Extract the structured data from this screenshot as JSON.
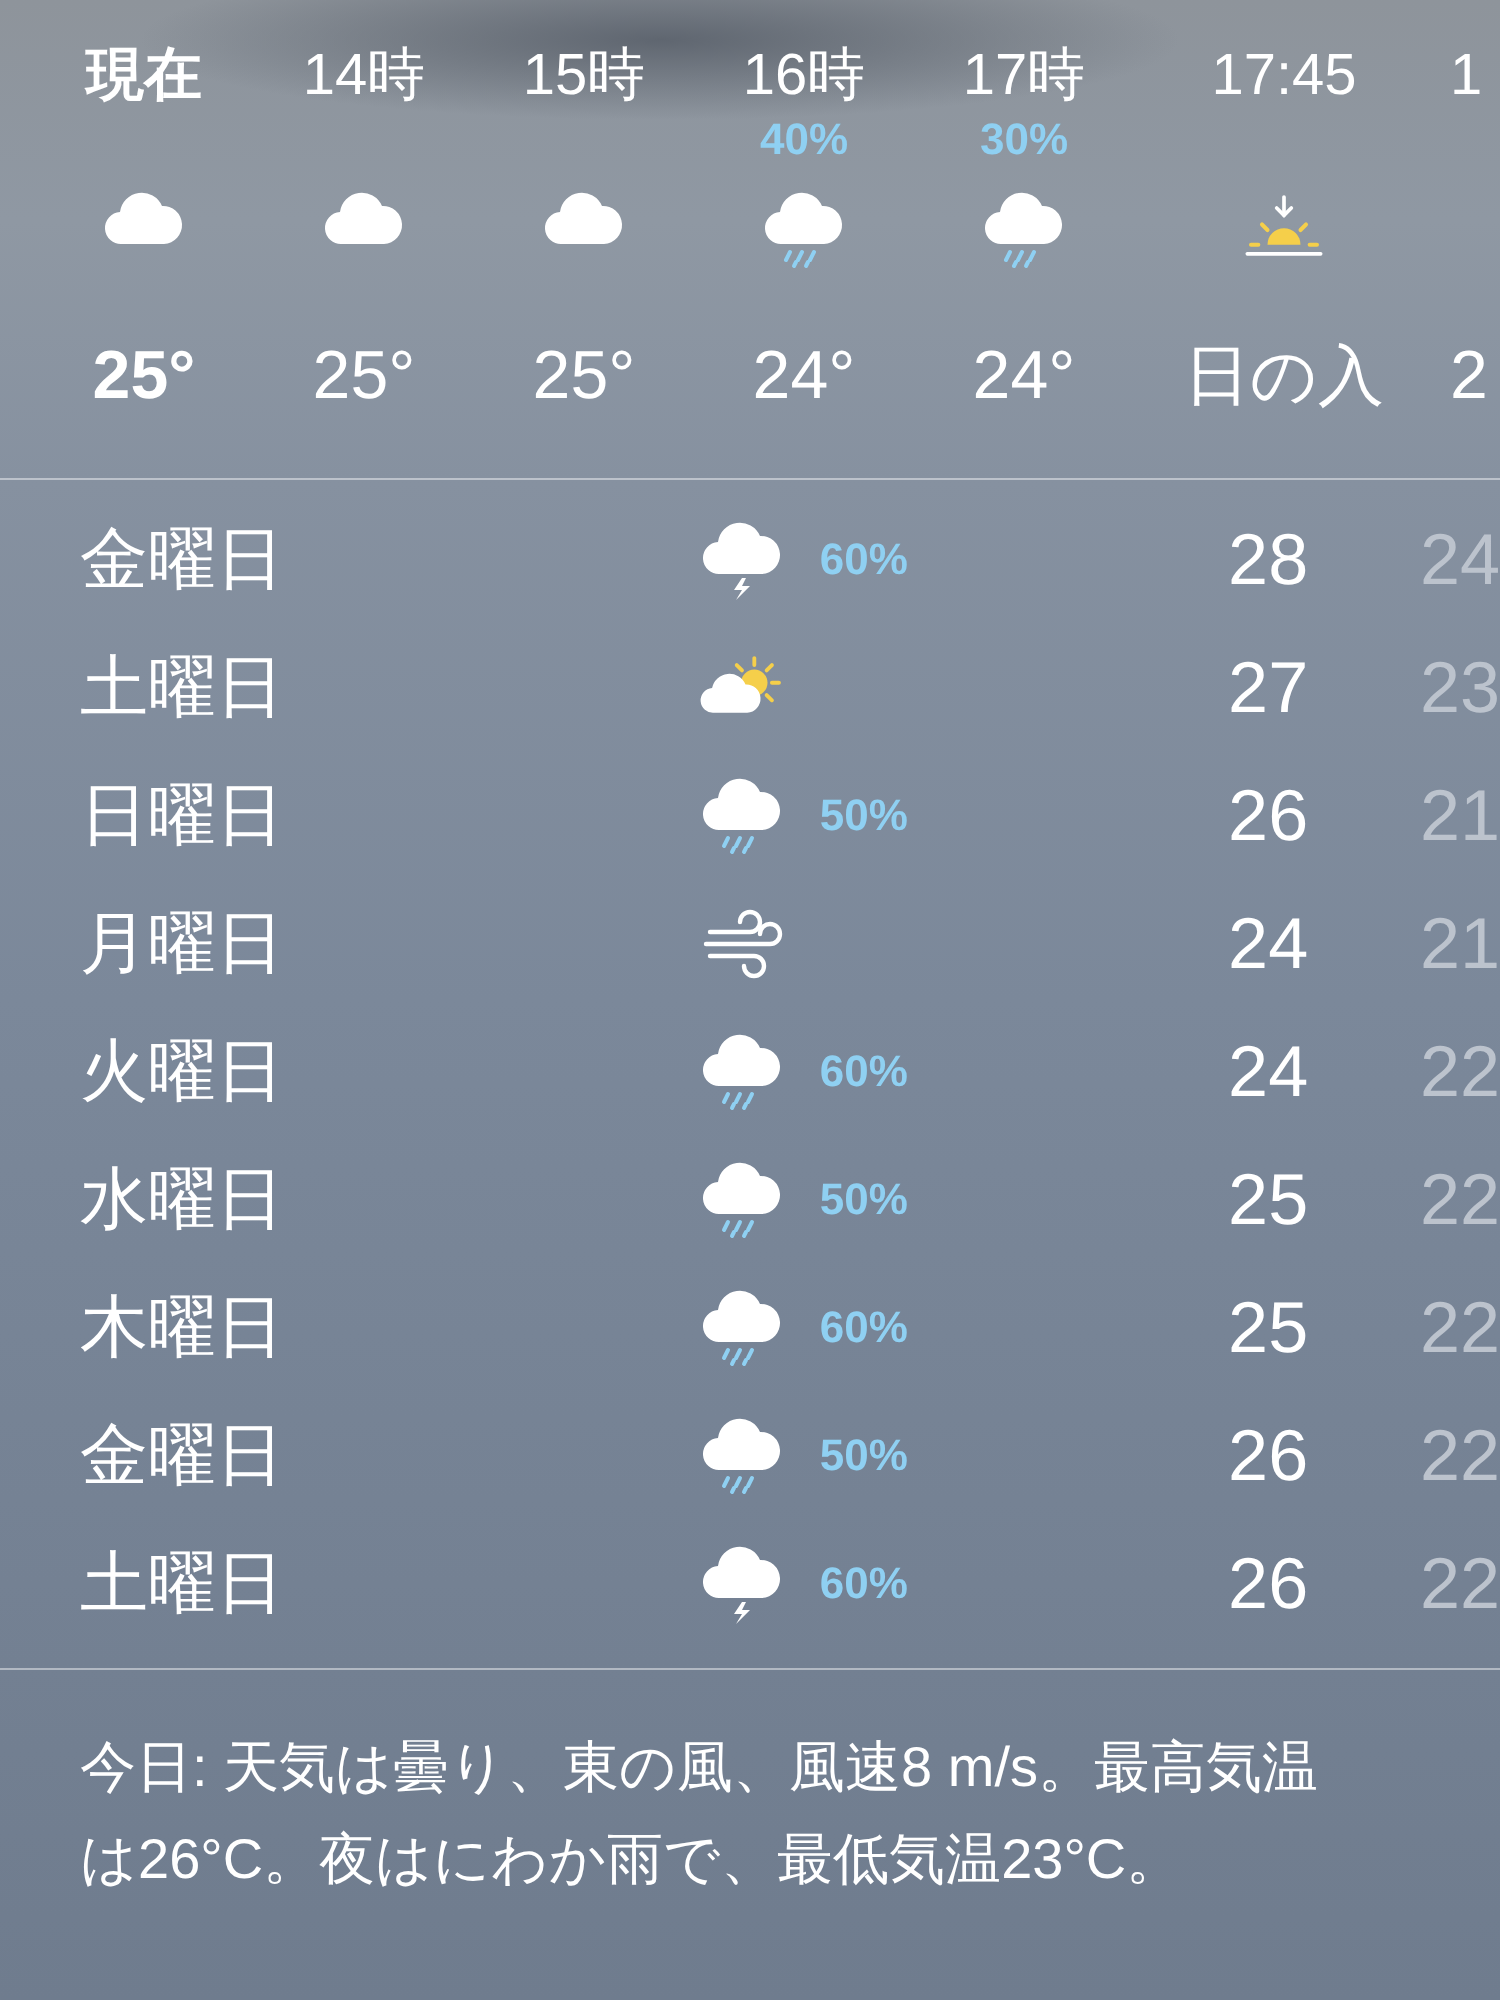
{
  "hourly": [
    {
      "time": "現在",
      "current": true,
      "kind": "cloud",
      "temp": "25°"
    },
    {
      "time": "14時",
      "current": false,
      "kind": "cloud",
      "temp": "25°"
    },
    {
      "time": "15時",
      "current": false,
      "kind": "cloud",
      "temp": "25°"
    },
    {
      "time": "16時",
      "current": false,
      "chance": "40%",
      "kind": "rain",
      "temp": "24°"
    },
    {
      "time": "17時",
      "current": false,
      "chance": "30%",
      "kind": "rain",
      "temp": "24°"
    },
    {
      "time": "17:45",
      "current": false,
      "kind": "sunset",
      "temp": "日の入"
    },
    {
      "time": "1",
      "current": false,
      "temp": "2"
    }
  ],
  "daily": [
    {
      "day": "金曜日",
      "kind": "thunder",
      "chance": "60%",
      "high": "28",
      "low": "24"
    },
    {
      "day": "土曜日",
      "kind": "partly_sunny",
      "high": "27",
      "low": "23"
    },
    {
      "day": "日曜日",
      "kind": "rain",
      "chance": "50%",
      "high": "26",
      "low": "21"
    },
    {
      "day": "月曜日",
      "kind": "wind",
      "high": "24",
      "low": "21"
    },
    {
      "day": "火曜日",
      "kind": "rain",
      "chance": "60%",
      "high": "24",
      "low": "22"
    },
    {
      "day": "水曜日",
      "kind": "rain",
      "chance": "50%",
      "high": "25",
      "low": "22"
    },
    {
      "day": "木曜日",
      "kind": "rain",
      "chance": "60%",
      "high": "25",
      "low": "22"
    },
    {
      "day": "金曜日",
      "kind": "rain",
      "chance": "50%",
      "high": "26",
      "low": "22"
    },
    {
      "day": "土曜日",
      "kind": "thunder",
      "chance": "60%",
      "high": "26",
      "low": "22"
    }
  ],
  "summary": "今日: 天気は曇り、東の風、風速8 m/s。最高気温は26°C。夜はにわか雨で、最低気温23°C。"
}
